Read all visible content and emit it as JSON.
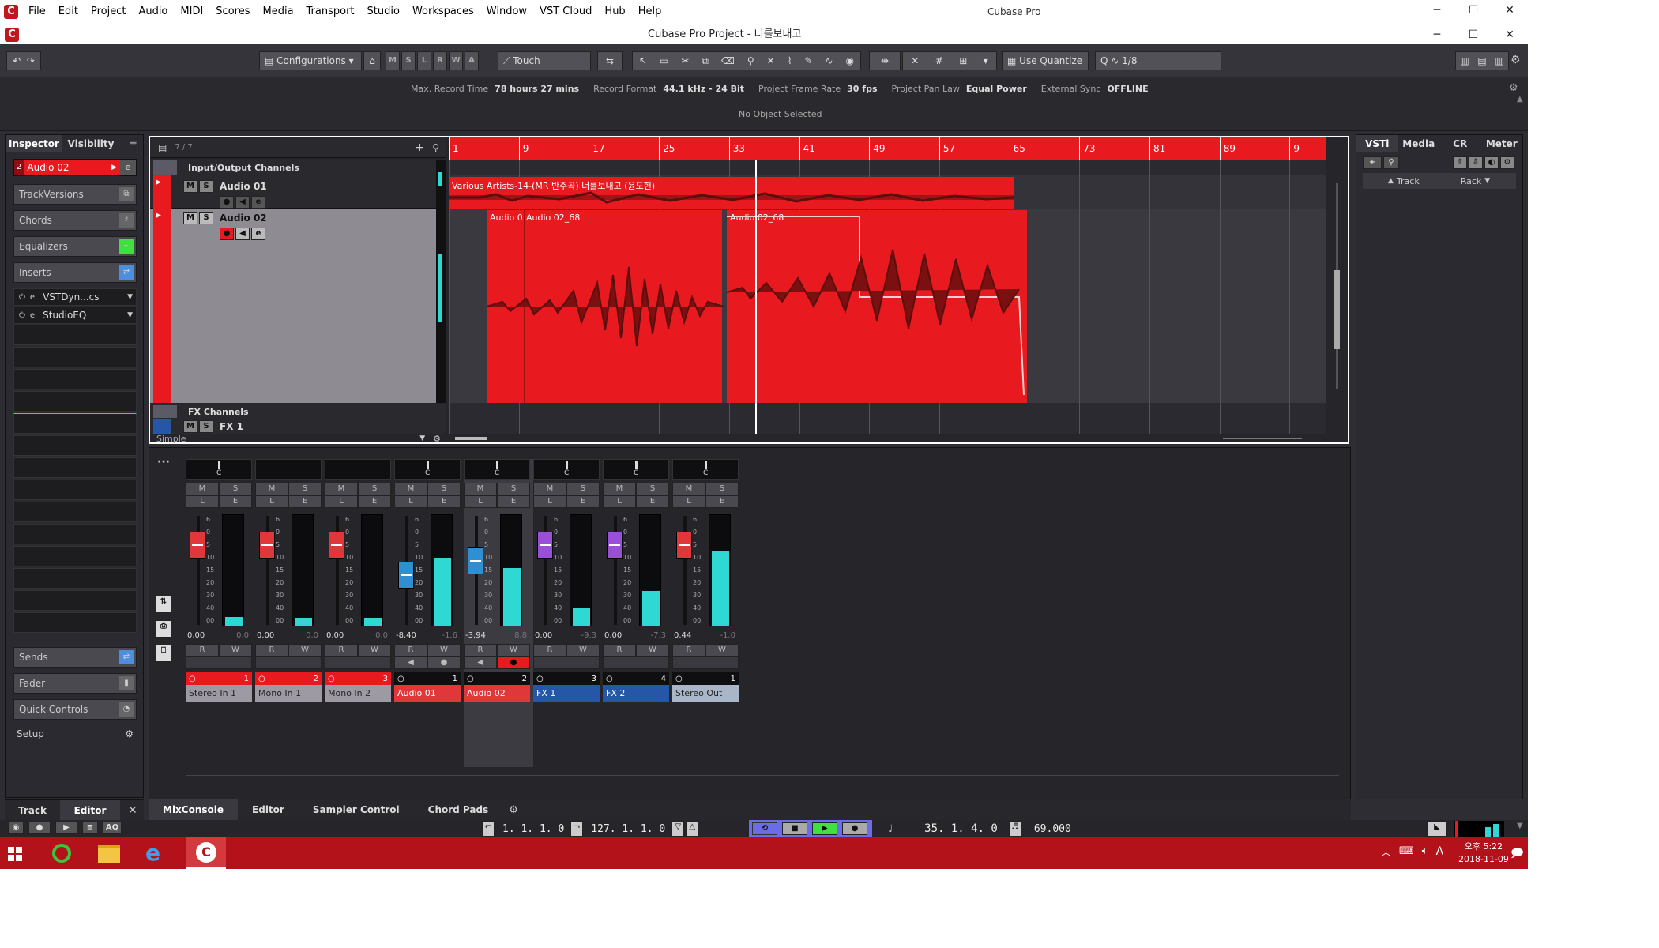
{
  "menu": [
    "File",
    "Edit",
    "Project",
    "Audio",
    "MIDI",
    "Scores",
    "Media",
    "Transport",
    "Studio",
    "Workspaces",
    "Window",
    "VST Cloud",
    "Hub",
    "Help"
  ],
  "app_title": "Cubase Pro",
  "project_title": "Cubase Pro Project - 너를보내고",
  "toolbar": {
    "configurations": "Configurations",
    "automation_mode": "Touch",
    "quantize_mode": "Use Quantize",
    "quantize_value": "1/8",
    "mswa": [
      "M",
      "S",
      "L",
      "R",
      "W",
      "A"
    ]
  },
  "status": {
    "max_record_time_label": "Max. Record Time",
    "max_record_time": "78 hours 27 mins",
    "record_format_label": "Record Format",
    "record_format": "44.1 kHz - 24 Bit",
    "frame_rate_label": "Project Frame Rate",
    "frame_rate": "30 fps",
    "pan_law_label": "Project Pan Law",
    "pan_law": "Equal Power",
    "ext_sync_label": "External Sync",
    "ext_sync": "OFFLINE",
    "no_object": "No Object Selected"
  },
  "inspector": {
    "tab_inspector": "Inspector",
    "tab_visibility": "Visibility",
    "track_number": "2",
    "track_name": "Audio 02",
    "sections": [
      "TrackVersions",
      "Chords",
      "Equalizers",
      "Inserts"
    ],
    "inserts": [
      "VSTDyn...cs",
      "StudioEQ"
    ],
    "bottom_sections": [
      "Sends",
      "Fader",
      "Quick Controls"
    ],
    "setup": "Setup"
  },
  "tracklist": {
    "count": "7 / 7",
    "folder_io": "Input/Output Channels",
    "tracks": [
      "Audio 01",
      "Audio 02"
    ],
    "folder_fx": "FX Channels",
    "fx_track": "FX 1",
    "preset": "Simple"
  },
  "ruler": [
    "1",
    "9",
    "17",
    "25",
    "33",
    "41",
    "49",
    "57",
    "65",
    "73",
    "81",
    "89",
    "9"
  ],
  "events": {
    "audio01_name": "Various Artists-14-(MR 반주곡) 너를보내고 (윤도현)",
    "audio02_a": "Audio 0",
    "audio02_b": "Audio 02_68",
    "audio02_c": "Audio 02_68"
  },
  "right_zone": {
    "tabs": [
      "VSTi",
      "Media",
      "CR",
      "Meter"
    ],
    "track_label": "Track",
    "rack_label": "Rack"
  },
  "mixer": {
    "channels": [
      {
        "name": "Stereo In 1",
        "num": "1",
        "fader": "0.00",
        "peak": "0.0",
        "color": "#e8e8e8",
        "level": 0.08,
        "cap": "#e0373a",
        "selected": false
      },
      {
        "name": "Mono In 1",
        "num": "2",
        "fader": "0.00",
        "peak": "0.0",
        "color": "#e8e8e8",
        "level": 0.07,
        "cap": "#e0373a",
        "selected": false
      },
      {
        "name": "Mono In 2",
        "num": "3",
        "fader": "0.00",
        "peak": "0.0",
        "color": "#e8e8e8",
        "level": 0.07,
        "cap": "#e0373a",
        "selected": false
      },
      {
        "name": "Audio 01",
        "num": "1",
        "fader": "-8.40",
        "peak": "-1.6",
        "color": "#e0373a",
        "level": 0.62,
        "cap": "#2f8fd0",
        "selected": false
      },
      {
        "name": "Audio 02",
        "num": "2",
        "fader": "-3.94",
        "peak": "8.8",
        "color": "#e0373a",
        "level": 0.53,
        "cap": "#2f8fd0",
        "selected": true
      },
      {
        "name": "FX 1",
        "num": "3",
        "fader": "0.00",
        "peak": "-9.3",
        "color": "#2556a8",
        "level": 0.17,
        "cap": "#9a4fd8",
        "selected": false
      },
      {
        "name": "FX 2",
        "num": "4",
        "fader": "0.00",
        "peak": "-7.3",
        "color": "#2556a8",
        "level": 0.32,
        "cap": "#9a4fd8",
        "selected": false
      },
      {
        "name": "Stereo Out",
        "num": "1",
        "fader": "0.44",
        "peak": "-1.0",
        "color": "#a9b6c8",
        "level": 0.69,
        "cap": "#e0373a",
        "selected": false
      }
    ],
    "scale": [
      "6",
      "0",
      "5",
      "10",
      "15",
      "20",
      "30",
      "40",
      "00"
    ]
  },
  "lower_tabs": {
    "left": [
      "Track",
      "Editor"
    ],
    "mid": [
      "MixConsole",
      "Editor",
      "Sampler Control",
      "Chord Pads"
    ]
  },
  "transport": {
    "left_locator": "1. 1. 1.   0",
    "right_locator": "127. 1. 1.   0",
    "position": "35. 1. 4.   0",
    "tempo": "69.000"
  },
  "taskbar": {
    "time": "오후 5:22",
    "date": "2018-11-09",
    "ime": "A"
  }
}
